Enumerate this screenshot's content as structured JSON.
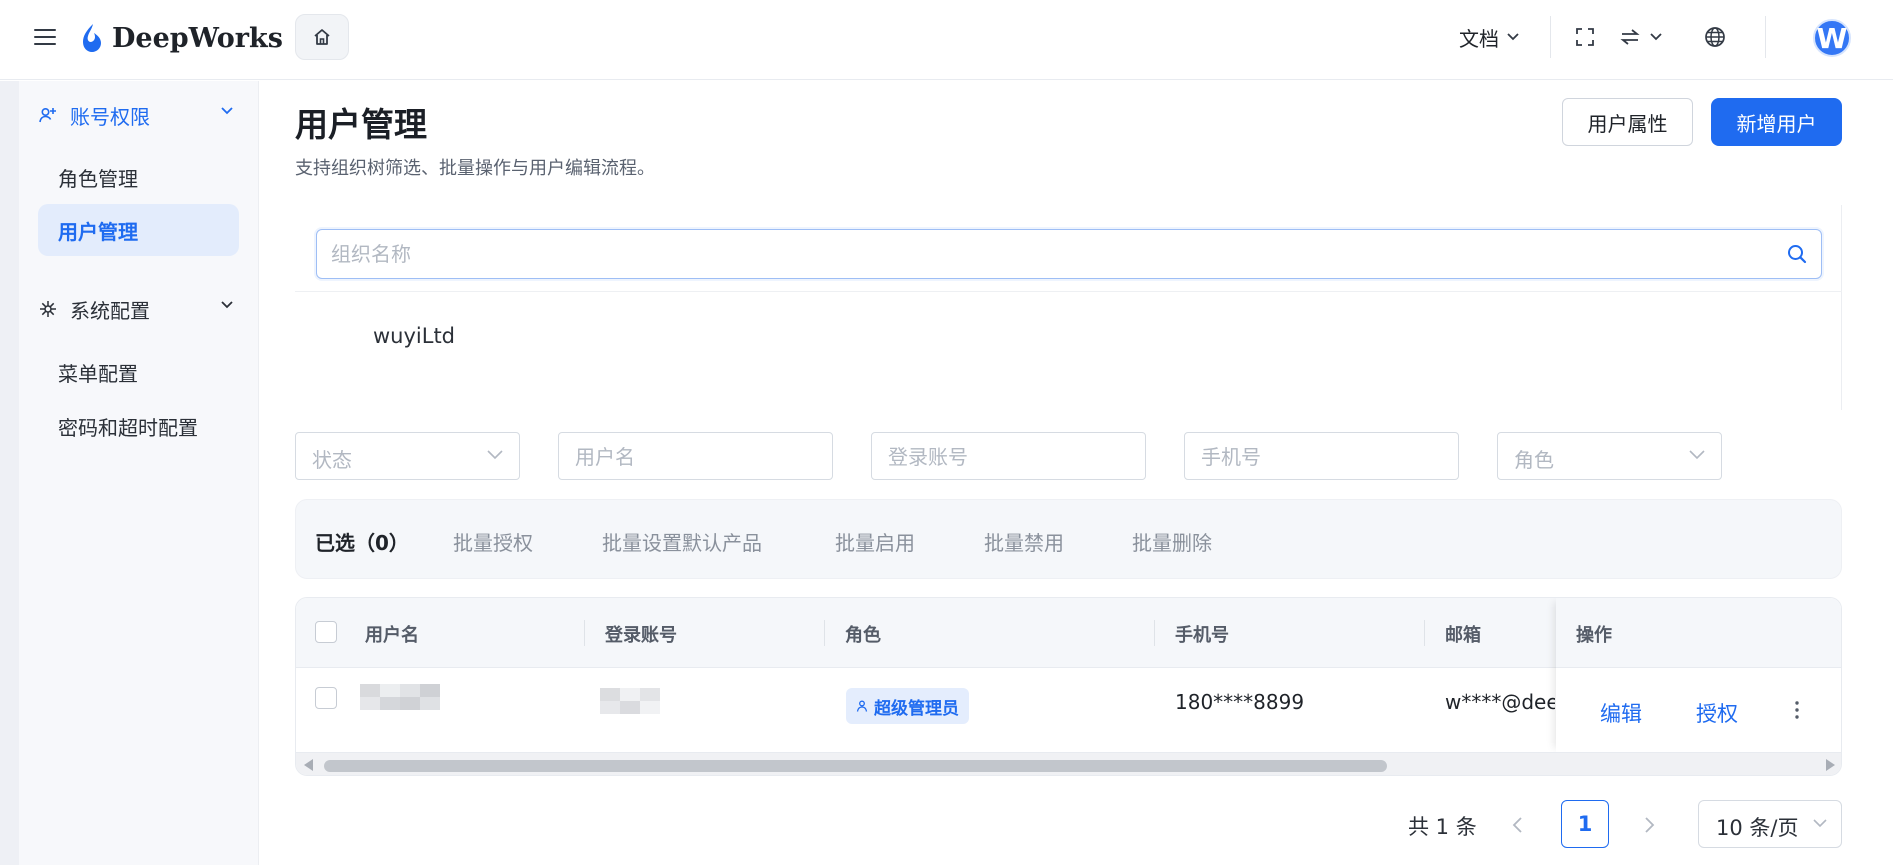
{
  "header": {
    "logo_text": "DeepWorks",
    "docs_label": "文档",
    "avatar_letter": "W",
    "colors": {
      "brand": "#1f6bf0",
      "avatar": "#3477f5"
    },
    "icons": [
      "menu-icon",
      "logo-icon",
      "home-icon",
      "chevron-down-icon",
      "fullscreen-icon",
      "swap-icon",
      "globe-icon"
    ]
  },
  "sidebar": {
    "groups": [
      {
        "label": "账号权限",
        "icon": "user-add-icon",
        "expanded": true,
        "items": [
          {
            "label": "角色管理"
          },
          {
            "label": "用户管理",
            "selected": true
          }
        ]
      },
      {
        "label": "系统配置",
        "icon": "settings-icon",
        "expanded": true,
        "items": [
          {
            "label": "菜单配置"
          },
          {
            "label": "密码和超时配置"
          }
        ]
      }
    ]
  },
  "main": {
    "title": "用户管理",
    "subtitle": "支持组织树筛选、批量操作与用户编辑流程。",
    "actions": {
      "attributes": "用户属性",
      "add_user": "新增用户"
    },
    "org": {
      "search_placeholder": "组织名称",
      "root_node": "wuyiLtd"
    },
    "filters": {
      "status_placeholder": "状态",
      "username_placeholder": "用户名",
      "login_placeholder": "登录账号",
      "phone_placeholder": "手机号",
      "role_placeholder": "角色"
    },
    "batch": {
      "selected": "已选（0）",
      "actions": [
        "批量授权",
        "批量设置默认产品",
        "批量启用",
        "批量禁用",
        "批量删除"
      ]
    },
    "table": {
      "columns": [
        "用户名",
        "登录账号",
        "角色",
        "手机号",
        "邮箱",
        "操作"
      ],
      "rows": [
        {
          "username": "",
          "login": "",
          "role": "超级管理员",
          "phone": "180****8899",
          "email": "w****@deep",
          "ops": [
            "编辑",
            "授权"
          ]
        }
      ]
    },
    "pagination": {
      "total": "共 1 条",
      "current_page": "1",
      "page_size": "10 条/页"
    }
  }
}
